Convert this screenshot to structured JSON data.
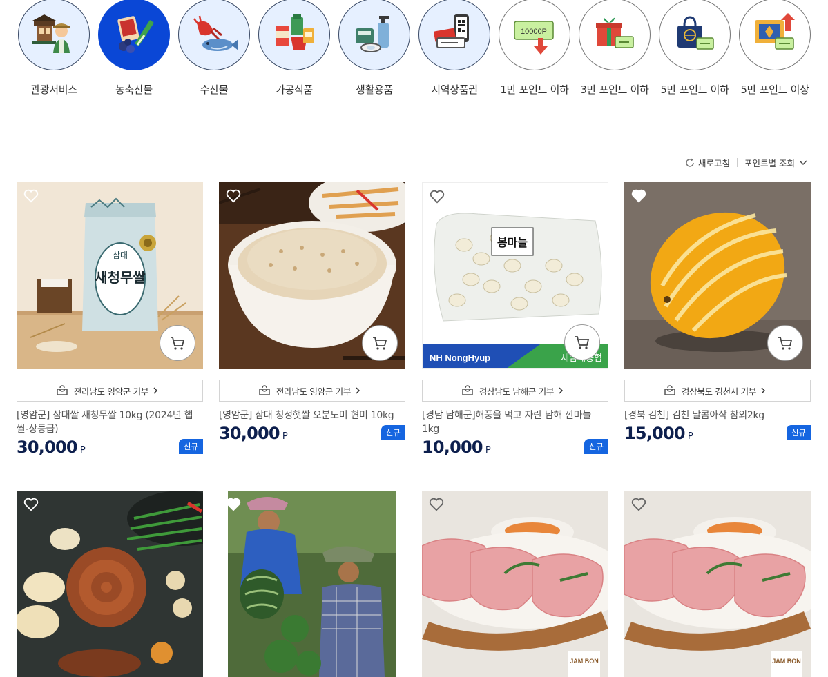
{
  "categories": [
    {
      "label": "관광서비스",
      "icon": "tour-guide-icon"
    },
    {
      "label": "농축산물",
      "icon": "produce-icon"
    },
    {
      "label": "수산물",
      "icon": "seafood-icon"
    },
    {
      "label": "가공식품",
      "icon": "processed-food-icon"
    },
    {
      "label": "생활용품",
      "icon": "household-icon"
    },
    {
      "label": "지역상품권",
      "icon": "voucher-icon"
    },
    {
      "label": "1만 포인트 이하",
      "icon": "point-card-icon",
      "card_text": "10000P"
    },
    {
      "label": "3만 포인트 이하",
      "icon": "gift-box-icon"
    },
    {
      "label": "5만 포인트 이하",
      "icon": "shopping-bag-icon"
    },
    {
      "label": "5만 포인트 이상",
      "icon": "premium-box-icon"
    }
  ],
  "toolbar": {
    "refresh_label": "새로고침",
    "sort_label": "포인트별 조회"
  },
  "products": [
    {
      "region": "전라남도 영암군 기부",
      "name": "[영암군] 삼대쌀 새청무쌀 10kg (2024년 햅쌀-상등급)",
      "price": "30,000",
      "unit": "P",
      "badge": "신규",
      "bag_brand": "삼대",
      "bag_title": "새청무쌀"
    },
    {
      "region": "전라남도 영암군 기부",
      "name": "[영암군] 삼대 청정햇쌀 오분도미 현미 10kg",
      "price": "30,000",
      "unit": "P",
      "badge": "신규"
    },
    {
      "region": "경상남도 남해군 기부",
      "name": "[경남 남해군]해풍을 먹고 자란 남해 깐마늘 1kg",
      "price": "10,000",
      "unit": "P",
      "badge": "신규",
      "banner_left": "NH NongHyup",
      "banner_right": "새남해농협",
      "pack_label": "봉마늘"
    },
    {
      "region": "경상북도 김천시 기부",
      "name": "[경북 김천] 김천 달콤아삭 참외2kg",
      "price": "15,000",
      "unit": "P",
      "badge": "신규"
    },
    {
      "region": "",
      "name": "",
      "price": "",
      "unit": "",
      "badge": ""
    },
    {
      "region": "",
      "name": "",
      "price": "",
      "unit": "",
      "badge": ""
    },
    {
      "region": "",
      "name": "",
      "price": "",
      "unit": "",
      "badge": "",
      "brand_tag": "JAM BON"
    },
    {
      "region": "",
      "name": "",
      "price": "",
      "unit": "",
      "badge": "",
      "brand_tag": "JAM BON"
    }
  ],
  "colors": {
    "accent": "#0a47d6",
    "circle_bg": "#e6f0ff",
    "price": "#0d1f4d",
    "badge": "#1565e0"
  }
}
